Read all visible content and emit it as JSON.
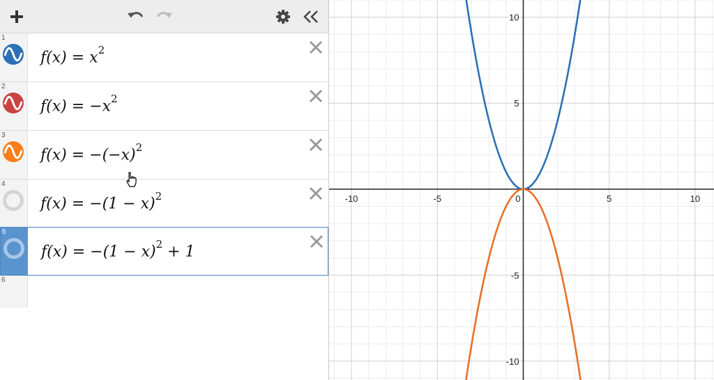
{
  "toolbar": {
    "add_icon": "plus-icon",
    "undo_icon": "undo-icon",
    "redo_icon": "redo-icon",
    "settings_icon": "gear-icon",
    "collapse_icon": "double-chevron-left-icon"
  },
  "expressions": [
    {
      "num": "1",
      "lhs": "f(x) = ",
      "body": "x",
      "sup": "2",
      "tail": "",
      "color": "#2d70b3",
      "icon": "wave-icon",
      "visible": true
    },
    {
      "num": "2",
      "lhs": "f(x) = ",
      "body": "−x",
      "sup": "2",
      "tail": "",
      "color": "#c74440",
      "icon": "wave-icon",
      "visible": true
    },
    {
      "num": "3",
      "lhs": "f(x) = ",
      "body": "−(−x)",
      "sup": "2",
      "tail": "",
      "color": "#fa7e19",
      "icon": "wave-icon",
      "visible": true
    },
    {
      "num": "4",
      "lhs": "f(x) = ",
      "body": "−(1 − x)",
      "sup": "2",
      "tail": "",
      "color": "#cccccc",
      "icon": "hidden-circle-icon",
      "visible": false
    },
    {
      "num": "5",
      "lhs": "f(x) = ",
      "body": "−(1 − x)",
      "sup": "2",
      "tail": " + 1",
      "color": "#cccccc",
      "icon": "hidden-circle-icon",
      "visible": false,
      "selected": true
    }
  ],
  "empty_row_num": "6",
  "graph": {
    "x_ticks": [
      "-10",
      "-5",
      "0",
      "5",
      "10"
    ],
    "y_ticks": [
      "10",
      "5",
      "-5",
      "-10"
    ],
    "x_range": [
      -11.3,
      11.1
    ],
    "y_range": [
      -11.1,
      11.0
    ],
    "curves": [
      {
        "name": "blue",
        "color": "#2d70b3",
        "sign": 1
      },
      {
        "name": "orange",
        "color": "#e8702a",
        "sign": -1
      }
    ]
  }
}
